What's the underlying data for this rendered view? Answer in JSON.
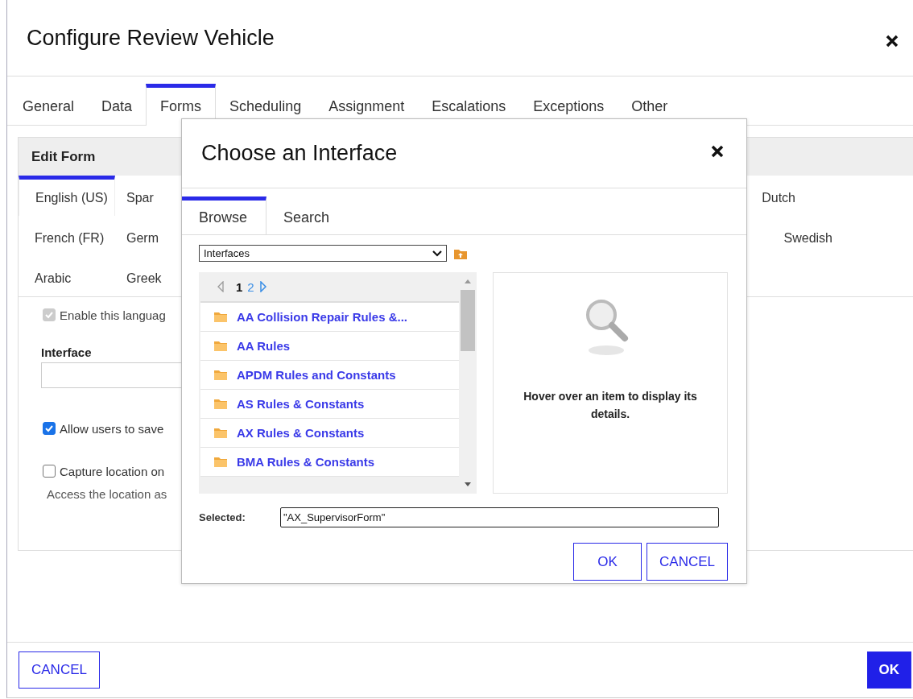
{
  "window": {
    "title": "Configure Review Vehicle"
  },
  "tabs": [
    {
      "label": "General",
      "selected": false
    },
    {
      "label": "Data",
      "selected": false
    },
    {
      "label": "Forms",
      "selected": true
    },
    {
      "label": "Scheduling",
      "selected": false
    },
    {
      "label": "Assignment",
      "selected": false
    },
    {
      "label": "Escalations",
      "selected": false
    },
    {
      "label": "Exceptions",
      "selected": false
    },
    {
      "label": "Other",
      "selected": false
    }
  ],
  "edit_form": {
    "title": "Edit Form",
    "language_rows": [
      {
        "tabs": [
          {
            "label": "English (US)",
            "selected": true
          },
          {
            "label": "Spar",
            "selected": false
          }
        ],
        "far_tabs": [
          {
            "label": "Dutch",
            "selected": false
          }
        ]
      },
      {
        "tabs": [
          {
            "label": "French (FR)",
            "selected": false
          },
          {
            "label": "Germ",
            "selected": false
          }
        ],
        "far_tabs": [
          {
            "label": "Swedish",
            "selected": false
          }
        ]
      },
      {
        "tabs": [
          {
            "label": "Arabic",
            "selected": false
          },
          {
            "label": "Greek",
            "selected": false
          }
        ],
        "far_tabs": []
      }
    ],
    "enable_option": {
      "label": "Enable this languag",
      "checked": true,
      "disabled": true
    },
    "interface_label": "Interface",
    "options": [
      {
        "label": "Allow users to save",
        "checked": true
      },
      {
        "label": "Capture location on",
        "checked": false
      }
    ],
    "note": "Access the location as"
  },
  "footer": {
    "cancel": "CANCEL",
    "ok": "OK"
  },
  "modal": {
    "title": "Choose an Interface",
    "tabs": [
      {
        "label": "Browse",
        "selected": true
      },
      {
        "label": "Search",
        "selected": false
      }
    ],
    "source": {
      "value": "Interfaces"
    },
    "pages": [
      {
        "label": "1",
        "selected": true
      },
      {
        "label": "2",
        "selected": false
      }
    ],
    "items": [
      "AA Collision Repair Rules &...",
      "AA Rules",
      "APDM Rules and Constants",
      "AS Rules & Constants",
      "AX Rules & Constants",
      "BMA Rules & Constants"
    ],
    "details_hint": "Hover over an item to display its details.",
    "selected_label": "Selected:",
    "selected_value": "\"AX_SupervisorForm\"",
    "buttons": {
      "ok": "OK",
      "cancel": "CANCEL"
    }
  }
}
